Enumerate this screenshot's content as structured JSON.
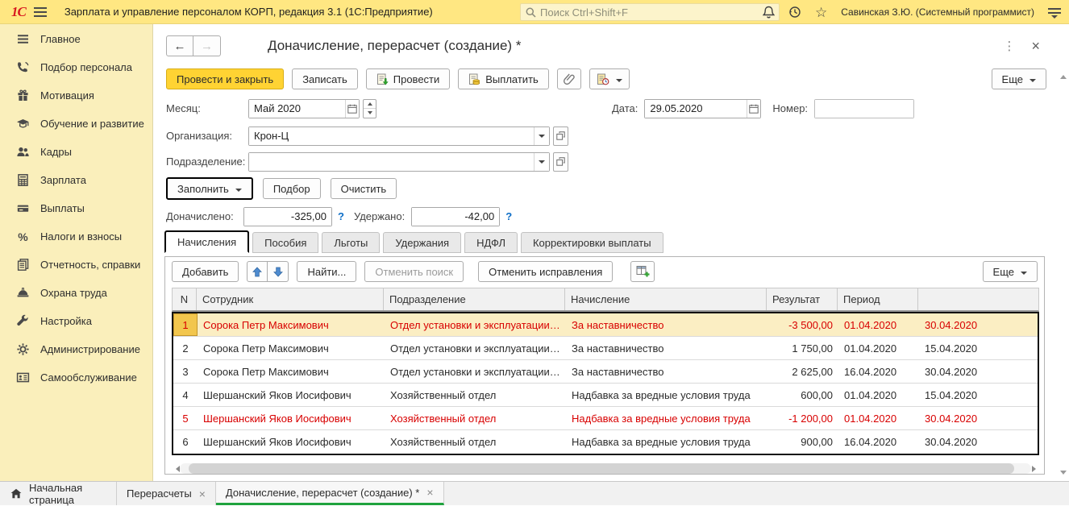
{
  "topbar": {
    "logo_text": "1С",
    "app_title": "Зарплата и управление персоналом КОРП, редакция 3.1  (1С:Предприятие)",
    "search_placeholder": "Поиск Ctrl+Shift+F",
    "user_name": "Савинская З.Ю. (Системный программист)"
  },
  "icons": {
    "back": "←",
    "forward": "→",
    "kebab": "⋮",
    "close": "×",
    "star": "☆",
    "percent": "%",
    "help": "?"
  },
  "sidebar": {
    "items": [
      {
        "label": "Главное"
      },
      {
        "label": "Подбор персонала"
      },
      {
        "label": "Мотивация"
      },
      {
        "label": "Обучение и развитие"
      },
      {
        "label": "Кадры"
      },
      {
        "label": "Зарплата"
      },
      {
        "label": "Выплаты"
      },
      {
        "label": "Налоги и взносы"
      },
      {
        "label": "Отчетность, справки"
      },
      {
        "label": "Охрана труда"
      },
      {
        "label": "Настройка"
      },
      {
        "label": "Администрирование"
      },
      {
        "label": "Самообслуживание"
      }
    ]
  },
  "form": {
    "title": "Доначисление, перерасчет (создание) *",
    "toolbar": {
      "post_close": "Провести и закрыть",
      "save": "Записать",
      "post": "Провести",
      "pay": "Выплатить",
      "more": "Еще"
    },
    "fields": {
      "month_label": "Месяц:",
      "month_value": "Май 2020",
      "date_label": "Дата:",
      "date_value": "29.05.2020",
      "number_label": "Номер:",
      "number_value": "",
      "organization_label": "Организация:",
      "organization_value": "Крон-Ц",
      "department_label": "Подразделение:",
      "department_value": ""
    },
    "fill_actions": {
      "fill": "Заполнить",
      "pick": "Подбор",
      "clear": "Очистить"
    },
    "totals": {
      "accrued_label": "Доначислено:",
      "accrued_value": "-325,00",
      "withheld_label": "Удержано:",
      "withheld_value": "-42,00"
    },
    "tabs": [
      "Начисления",
      "Пособия",
      "Льготы",
      "Удержания",
      "НДФЛ",
      "Корректировки выплаты"
    ],
    "active_tab": "Начисления"
  },
  "grid": {
    "toolbar": {
      "add": "Добавить",
      "find": "Найти...",
      "cancel_search": "Отменить поиск",
      "cancel_fixes": "Отменить исправления",
      "more": "Еще"
    },
    "columns": {
      "n": "N",
      "employee": "Сотрудник",
      "department": "Подразделение",
      "accrual": "Начисление",
      "result": "Результат",
      "period": "Период"
    },
    "rows": [
      {
        "n": "1",
        "employee": "Сорока Петр Максимович",
        "department": "Отдел установки и эксплуатации…",
        "accrual": "За наставничество",
        "result": "-3 500,00",
        "period_start": "01.04.2020",
        "period_end": "30.04.2020",
        "storno": true,
        "selected": true
      },
      {
        "n": "2",
        "employee": "Сорока Петр Максимович",
        "department": "Отдел установки и эксплуатации…",
        "accrual": "За наставничество",
        "result": "1 750,00",
        "period_start": "01.04.2020",
        "period_end": "15.04.2020",
        "storno": false,
        "selected": false
      },
      {
        "n": "3",
        "employee": "Сорока Петр Максимович",
        "department": "Отдел установки и эксплуатации…",
        "accrual": "За наставничество",
        "result": "2 625,00",
        "period_start": "16.04.2020",
        "period_end": "30.04.2020",
        "storno": false,
        "selected": false
      },
      {
        "n": "4",
        "employee": "Шершанский Яков Иосифович",
        "department": "Хозяйственный отдел",
        "accrual": "Надбавка за вредные условия труда",
        "result": "600,00",
        "period_start": "01.04.2020",
        "period_end": "15.04.2020",
        "storno": false,
        "selected": false
      },
      {
        "n": "5",
        "employee": "Шершанский Яков Иосифович",
        "department": "Хозяйственный отдел",
        "accrual": "Надбавка за вредные условия труда",
        "result": "-1 200,00",
        "period_start": "01.04.2020",
        "period_end": "30.04.2020",
        "storno": true,
        "selected": false
      },
      {
        "n": "6",
        "employee": "Шершанский Яков Иосифович",
        "department": "Хозяйственный отдел",
        "accrual": "Надбавка за вредные условия труда",
        "result": "900,00",
        "period_start": "16.04.2020",
        "period_end": "30.04.2020",
        "storno": false,
        "selected": false
      }
    ]
  },
  "taskbar": {
    "home_label": "Начальная страница",
    "tabs": [
      {
        "label": "Перерасчеты",
        "active": false
      },
      {
        "label": "Доначисление, перерасчет (создание) *",
        "active": true
      }
    ]
  },
  "colors": {
    "topbar_yellow": "#FFE782",
    "sidebar_yellow": "#FAEFBB",
    "primary_button_yellow": "#FFD333",
    "storno_red": "#D80000",
    "selected_row_yellow": "#FBEEC3",
    "active_tab_green": "#1FA23D",
    "link_blue": "#0D6EC7"
  }
}
